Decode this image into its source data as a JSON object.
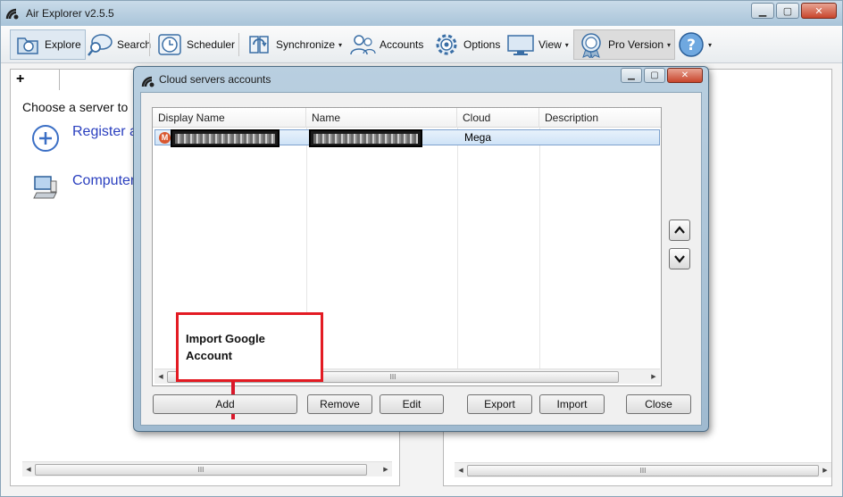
{
  "window": {
    "title": "Air Explorer v2.5.5",
    "minimize": "▁",
    "maximize": "▢",
    "close": "✕"
  },
  "toolbar": {
    "explore": "Explore",
    "search": "Search",
    "scheduler": "Scheduler",
    "synchronize": "Synchronize",
    "accounts": "Accounts",
    "options": "Options",
    "view": "View",
    "pro_version": "Pro Version",
    "dropdown_glyph": "▾"
  },
  "left_pane": {
    "tab_plus": "+",
    "choose_text": "Choose a server to",
    "items": [
      {
        "label": "Register a",
        "icon": "plus-circle-icon"
      },
      {
        "label": "Computer",
        "icon": "computer-icon"
      }
    ]
  },
  "dialog": {
    "title": "Cloud servers accounts",
    "columns": [
      "Display Name",
      "Name",
      "Cloud",
      "Description"
    ],
    "rows": [
      {
        "icon": "mega-icon",
        "icon_letter": "M",
        "display_name": "",
        "name": "",
        "cloud": "Mega",
        "description": ""
      }
    ],
    "buttons": {
      "add": "Add",
      "remove": "Remove",
      "edit": "Edit",
      "export": "Export",
      "import": "Import",
      "close": "Close"
    },
    "scroll_up_glyph": "▲",
    "scroll_down_glyph": "▼"
  },
  "annotation": {
    "text": "Import Google Account",
    "color": "#e31b23"
  },
  "scrollbar": {
    "left_arrow": "◀",
    "right_arrow": "▶",
    "grip": "III"
  },
  "colors": {
    "link_blue": "#2a3fbf",
    "selection": "#cfe3f7",
    "mega_red": "#d9572f"
  }
}
